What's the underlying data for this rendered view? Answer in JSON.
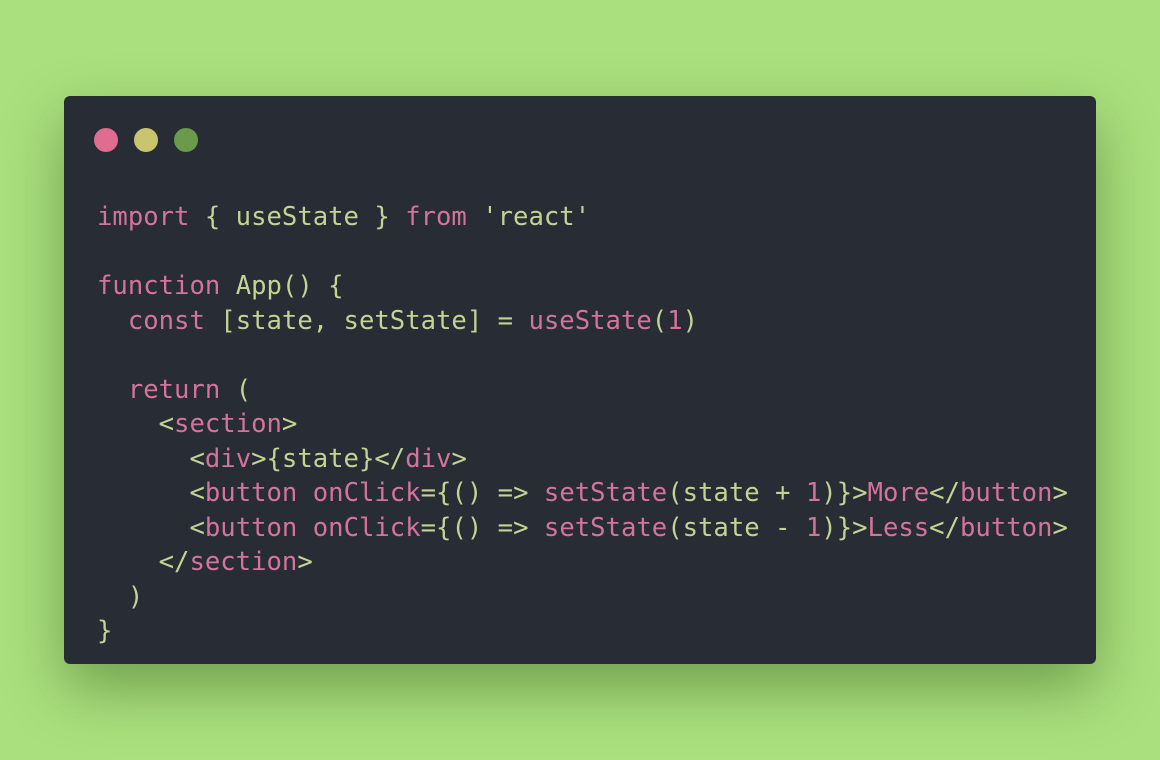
{
  "window": {
    "controls": [
      {
        "name": "close",
        "color": "#e06c8f"
      },
      {
        "name": "minimize",
        "color": "#c9c46e"
      },
      {
        "name": "maximize",
        "color": "#6a9a4a"
      }
    ]
  },
  "theme": {
    "background": "#abe07e",
    "editor_background": "#282c34",
    "keyword_color": "#d3749a",
    "text_color": "#c2d494"
  },
  "code_lines": [
    [
      {
        "t": "import",
        "c": "kw"
      },
      {
        "t": " { useState } ",
        "c": "pl"
      },
      {
        "t": "from",
        "c": "kw"
      },
      {
        "t": " 'react'",
        "c": "pl"
      }
    ],
    [],
    [
      {
        "t": "function",
        "c": "kw"
      },
      {
        "t": " App() {",
        "c": "pl"
      }
    ],
    [
      {
        "t": "  ",
        "c": "pl"
      },
      {
        "t": "const",
        "c": "kw"
      },
      {
        "t": " [state, setState] = ",
        "c": "pl"
      },
      {
        "t": "useState",
        "c": "kw"
      },
      {
        "t": "(",
        "c": "pl"
      },
      {
        "t": "1",
        "c": "kw"
      },
      {
        "t": ")",
        "c": "pl"
      }
    ],
    [],
    [
      {
        "t": "  ",
        "c": "pl"
      },
      {
        "t": "return",
        "c": "kw"
      },
      {
        "t": " (",
        "c": "pl"
      }
    ],
    [
      {
        "t": "    <",
        "c": "pl"
      },
      {
        "t": "section",
        "c": "kw"
      },
      {
        "t": ">",
        "c": "pl"
      }
    ],
    [
      {
        "t": "      <",
        "c": "pl"
      },
      {
        "t": "div",
        "c": "kw"
      },
      {
        "t": ">{state}</",
        "c": "pl"
      },
      {
        "t": "div",
        "c": "kw"
      },
      {
        "t": ">",
        "c": "pl"
      }
    ],
    [
      {
        "t": "      <",
        "c": "pl"
      },
      {
        "t": "button",
        "c": "kw"
      },
      {
        "t": " ",
        "c": "pl"
      },
      {
        "t": "onClick",
        "c": "kw"
      },
      {
        "t": "={() => ",
        "c": "pl"
      },
      {
        "t": "setState",
        "c": "kw"
      },
      {
        "t": "(state + ",
        "c": "pl"
      },
      {
        "t": "1",
        "c": "kw"
      },
      {
        "t": ")}>",
        "c": "pl"
      },
      {
        "t": "More",
        "c": "kw"
      },
      {
        "t": "</",
        "c": "pl"
      },
      {
        "t": "button",
        "c": "kw"
      },
      {
        "t": ">",
        "c": "pl"
      }
    ],
    [
      {
        "t": "      <",
        "c": "pl"
      },
      {
        "t": "button",
        "c": "kw"
      },
      {
        "t": " ",
        "c": "pl"
      },
      {
        "t": "onClick",
        "c": "kw"
      },
      {
        "t": "={() => ",
        "c": "pl"
      },
      {
        "t": "setState",
        "c": "kw"
      },
      {
        "t": "(state - ",
        "c": "pl"
      },
      {
        "t": "1",
        "c": "kw"
      },
      {
        "t": ")}>",
        "c": "pl"
      },
      {
        "t": "Less",
        "c": "kw"
      },
      {
        "t": "</",
        "c": "pl"
      },
      {
        "t": "button",
        "c": "kw"
      },
      {
        "t": ">",
        "c": "pl"
      }
    ],
    [
      {
        "t": "    </",
        "c": "pl"
      },
      {
        "t": "section",
        "c": "kw"
      },
      {
        "t": ">",
        "c": "pl"
      }
    ],
    [
      {
        "t": "  )",
        "c": "pl"
      }
    ],
    [
      {
        "t": "}",
        "c": "pl"
      }
    ]
  ]
}
